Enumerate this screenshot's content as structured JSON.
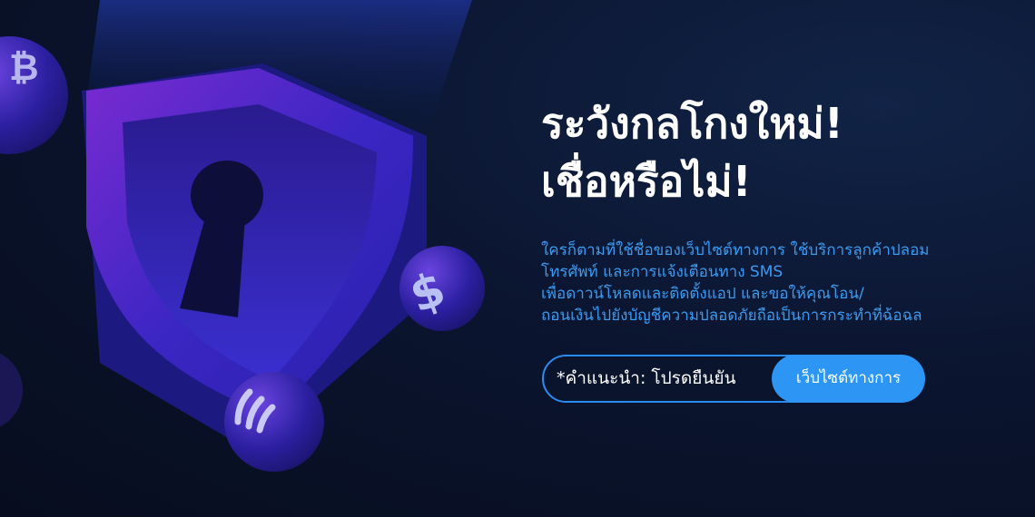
{
  "headline": {
    "line1": "ระวังกลโกงใหม่!",
    "line2": "เชื่อหรือไม่!"
  },
  "body": {
    "line1": "ใครก็ตามที่ใช้ชื่อของเว็บไซต์ทางการ ใช้บริการลูกค้าปลอม",
    "line2": "โทรศัพท์ และการแจ้งเตือนทาง SMS",
    "line3": "เพื่อดาวน์โหลดและติดตั้งแอป และขอให้คุณโอน/",
    "line4": "ถอนเงินไปยังบัญชีความปลอดภัยถือเป็นการกระทำที่ฉ้อฉล"
  },
  "cta": {
    "label": "*คำแนะนำ: โปรดยืนยัน",
    "button": "เว็บไซต์ทางการ"
  },
  "colors": {
    "accent": "#2d96f5",
    "body_text": "#3a9bf2",
    "background": "#0b1530",
    "shield": "#3a1fb0"
  },
  "icons": [
    "shield-keyhole-icon",
    "dollar-coin-icon",
    "nfc-coin-icon",
    "bitcoin-coin-icon"
  ]
}
